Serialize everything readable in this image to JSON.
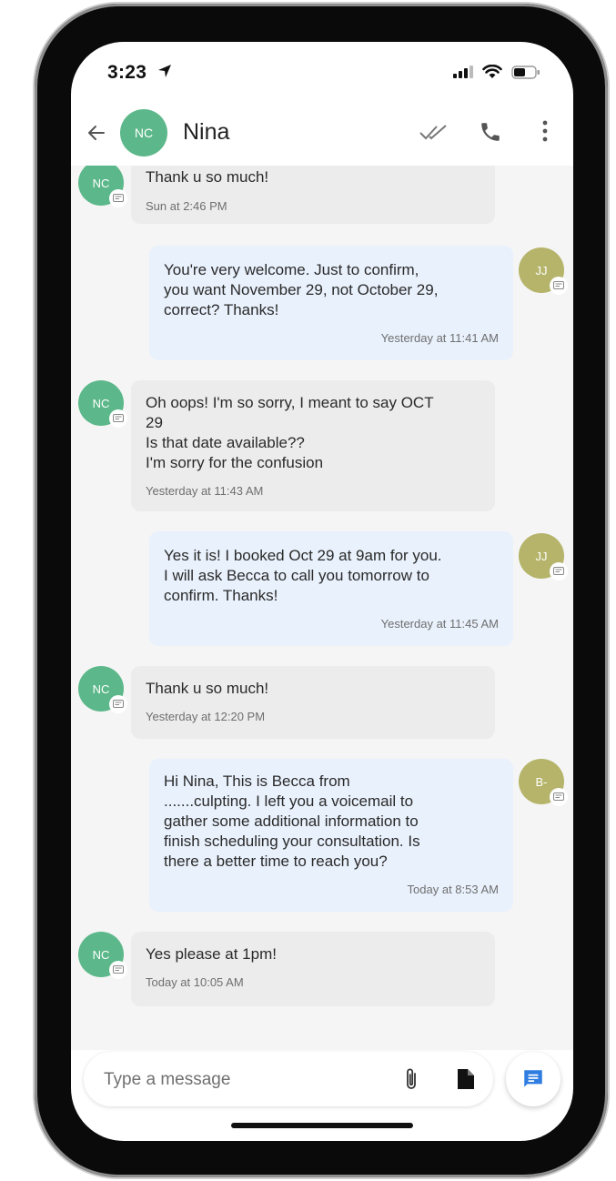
{
  "status_bar": {
    "time": "3:23"
  },
  "header": {
    "avatar_initials": "NC",
    "contact_name": "Nina"
  },
  "messages": [
    {
      "direction": "in",
      "avatar": "NC",
      "text": "Thank u so much!",
      "time": "Sun at 2:46 PM"
    },
    {
      "direction": "out",
      "avatar": "JJ",
      "text": "You're very welcome. Just to confirm,\nyou want November 29, not October 29,\ncorrect? Thanks!",
      "time": "Yesterday at 11:41 AM"
    },
    {
      "direction": "in",
      "avatar": "NC",
      "text": "Oh oops! I'm so sorry, I meant to say OCT\n29\nIs that date available??\nI'm sorry for the confusion",
      "time": "Yesterday at 11:43 AM"
    },
    {
      "direction": "out",
      "avatar": "JJ",
      "text": "Yes it is! I booked Oct 29 at 9am for you.\nI will ask Becca to call you tomorrow to\nconfirm. Thanks!",
      "time": "Yesterday at 11:45 AM"
    },
    {
      "direction": "in",
      "avatar": "NC",
      "text": "Thank u so much!",
      "time": "Yesterday at 12:20 PM"
    },
    {
      "direction": "out",
      "avatar": "B-",
      "text": "Hi Nina, This is Becca from\n.......culpting. I left you a voicemail to\ngather some additional information to\nfinish scheduling your consultation. Is\nthere a better time to reach you?",
      "time": "Today at 8:53 AM"
    },
    {
      "direction": "in",
      "avatar": "NC",
      "text": "Yes please at 1pm!",
      "time": "Today at 10:05 AM"
    }
  ],
  "composer": {
    "placeholder": "Type a message"
  },
  "colors": {
    "incoming_bubble": "#ececec",
    "outgoing_bubble": "#e9f1fc",
    "contact_avatar": "#5cb88a",
    "staff_avatar": "#b5b46a",
    "send_icon": "#2f7de1"
  }
}
